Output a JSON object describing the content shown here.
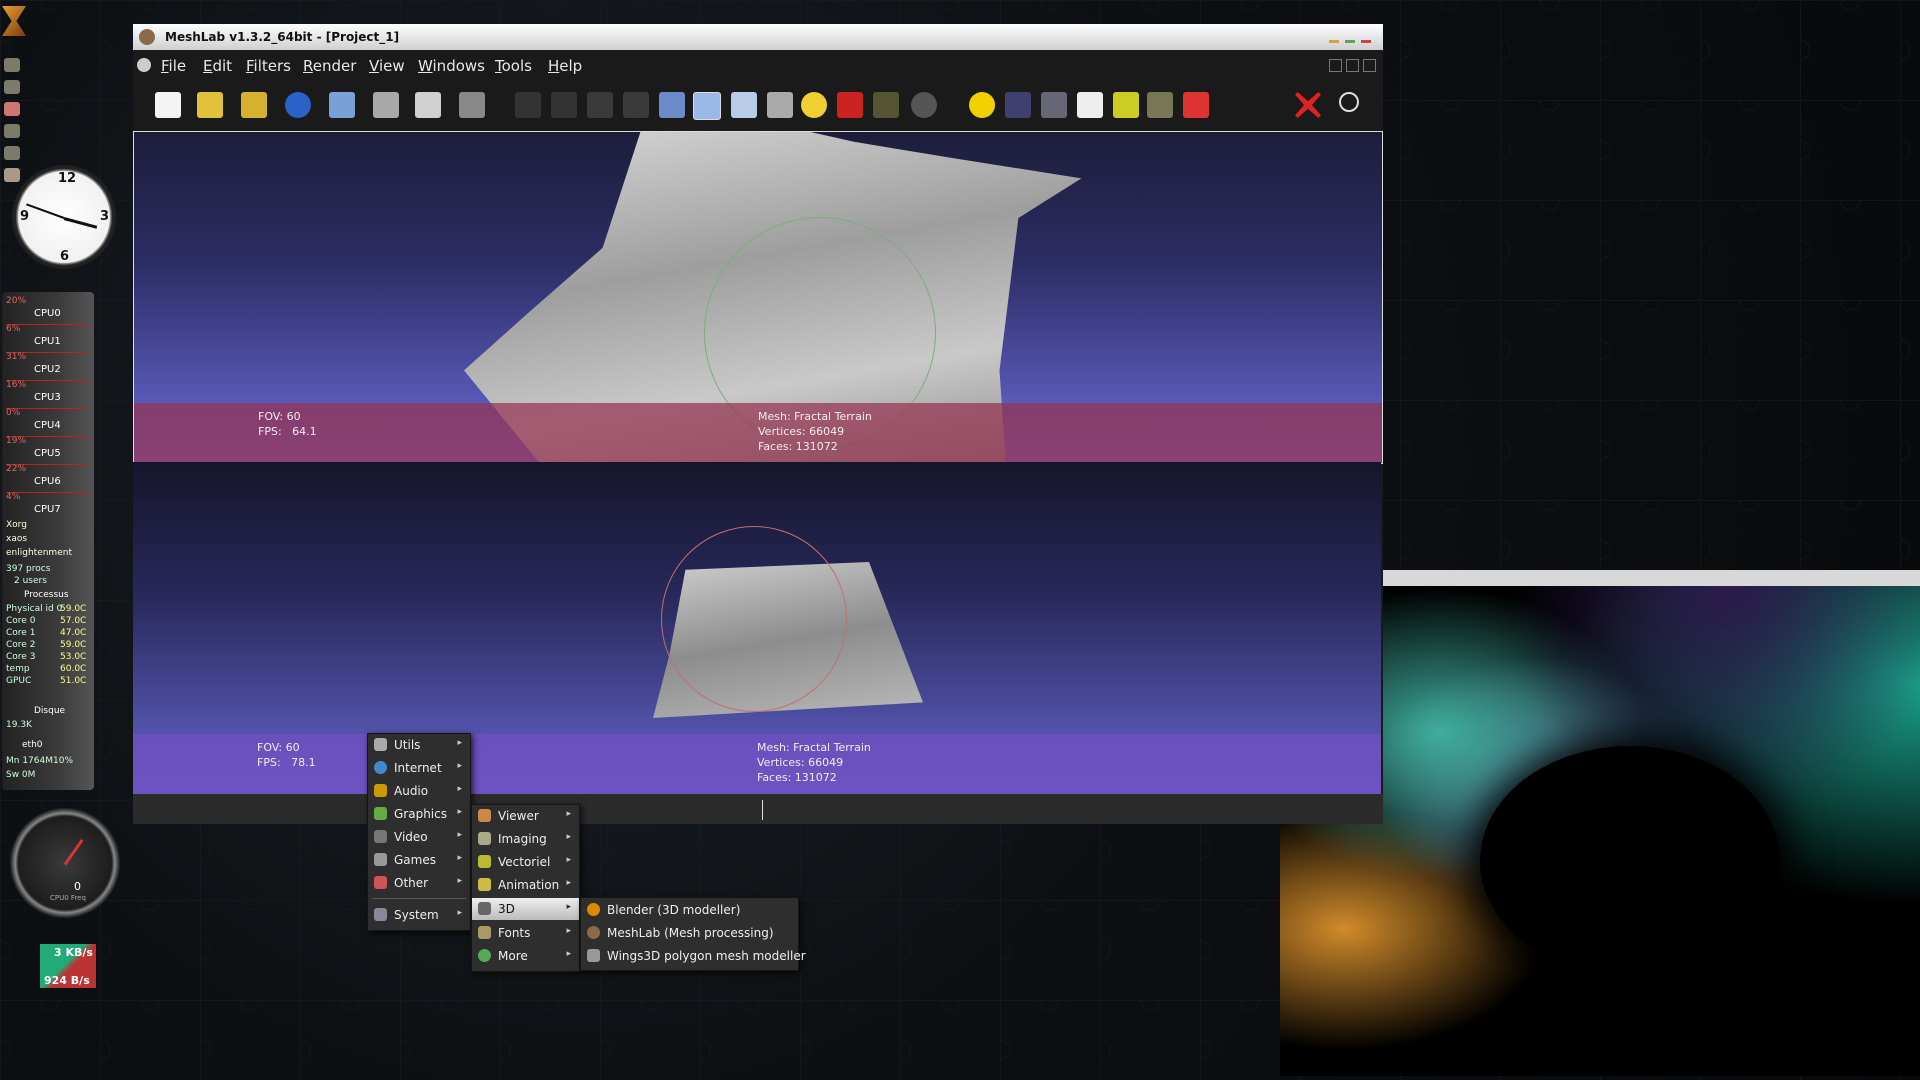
{
  "window": {
    "title": "MeshLab v1.3.2_64bit - [Project_1]",
    "menu": [
      "File",
      "Edit",
      "Filters",
      "Render",
      "View",
      "Windows",
      "Tools",
      "Help"
    ]
  },
  "viewports": [
    {
      "fov": "FOV: 60",
      "fps": "FPS:   64.1",
      "mesh": "Mesh: Fractal Terrain",
      "vertices": "Vertices: 66049",
      "faces": "Faces: 131072"
    },
    {
      "fov": "FOV: 60",
      "fps": "FPS:   78.1",
      "mesh": "Mesh: Fractal Terrain",
      "vertices": "Vertices: 66049",
      "faces": "Faces: 131072"
    }
  ],
  "app_menu": {
    "main": [
      "Utils",
      "Internet",
      "Audio",
      "Graphics",
      "Video",
      "Games",
      "Other",
      "System"
    ],
    "graphics_sub": [
      "Viewer",
      "Imaging",
      "Vectoriel",
      "Animation",
      "3D",
      "Fonts",
      "More"
    ],
    "three_d_sub": [
      "Blender (3D modeller)",
      "MeshLab (Mesh processing)",
      "Wings3D polygon mesh modeller"
    ]
  },
  "system_monitor": {
    "cpus": [
      "CPU0",
      "CPU1",
      "CPU2",
      "CPU3",
      "CPU4",
      "CPU5",
      "CPU6",
      "CPU7"
    ],
    "cpu_pct": [
      "20%",
      "6%",
      "31%",
      "16%",
      "0%",
      "19%",
      "22%",
      "4%"
    ],
    "procs": [
      "Xorg",
      "xaos",
      "enlightenment"
    ],
    "proc_count": "397 procs",
    "users": "2 users",
    "sensor_title": "Processus",
    "sensors": [
      {
        "name": "Physical id 0",
        "val": "59.0C"
      },
      {
        "name": "Core 0",
        "val": "57.0C"
      },
      {
        "name": "Core 1",
        "val": "47.0C"
      },
      {
        "name": "Core 2",
        "val": "59.0C"
      },
      {
        "name": "Core 3",
        "val": "53.0C"
      },
      {
        "name": "temp",
        "val": "60.0C"
      },
      {
        "name": "GPUC",
        "val": "51.0C"
      }
    ],
    "disk_title": "Disque",
    "disk_rate": "19.3K",
    "iface": "eth0",
    "mem": "Mn 1764M10%",
    "swap": "Sw  0M",
    "gauge_value": "0",
    "gauge_label": "CPU0 Freq",
    "net_up": "3 KB/s",
    "net_down": "924 B/s"
  },
  "colors": {
    "menu_bg": "#2e2e2e",
    "info_band_1": "#963250",
    "info_band_2": "#6e50be"
  }
}
